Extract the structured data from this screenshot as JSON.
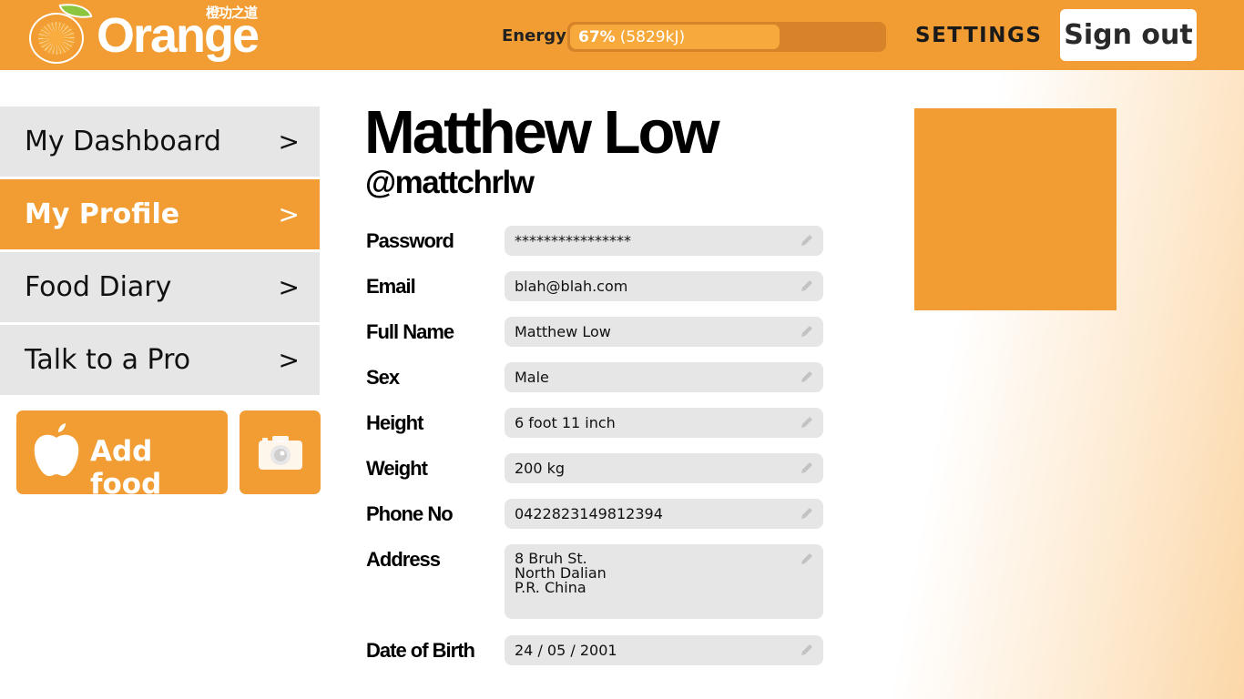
{
  "header": {
    "logo_text": "Orange",
    "logo_subtitle": "橙功之道",
    "energy_label": "Energy",
    "energy_percent_text": "67%",
    "energy_kj_text": "(5829kJ)",
    "energy_fraction": 0.67,
    "settings_label": "SETTINGS",
    "signout_label": "Sign out"
  },
  "sidebar": {
    "items": [
      {
        "label": "My Dashboard",
        "arrow": ">",
        "active": false
      },
      {
        "label": "My Profile",
        "arrow": ">",
        "active": true
      },
      {
        "label": "Food Diary",
        "arrow": ">",
        "active": false
      },
      {
        "label": "Talk to a Pro",
        "arrow": ">",
        "active": false
      }
    ],
    "add_food_label": "Add food"
  },
  "profile": {
    "name": "Matthew Low",
    "handle": "@mattchrlw",
    "fields": [
      {
        "label": "Password",
        "value": "****************"
      },
      {
        "label": "Email",
        "value": "blah@blah.com"
      },
      {
        "label": "Full Name",
        "value": "Matthew Low"
      },
      {
        "label": "Sex",
        "value": "Male"
      },
      {
        "label": "Height",
        "value": "6 foot 11 inch"
      },
      {
        "label": "Weight",
        "value": "200 kg"
      },
      {
        "label": "Phone No",
        "value": "0422823149812394"
      },
      {
        "label": "Address",
        "value": "8 Bruh St.\nNorth Dalian\nP.R. China"
      },
      {
        "label": "Date of Birth",
        "value": "24 / 05 / 2001"
      }
    ]
  },
  "colors": {
    "brand": "#f29d33",
    "nav_inactive": "#e6e6e6",
    "field_bg": "#e6e6e6"
  }
}
